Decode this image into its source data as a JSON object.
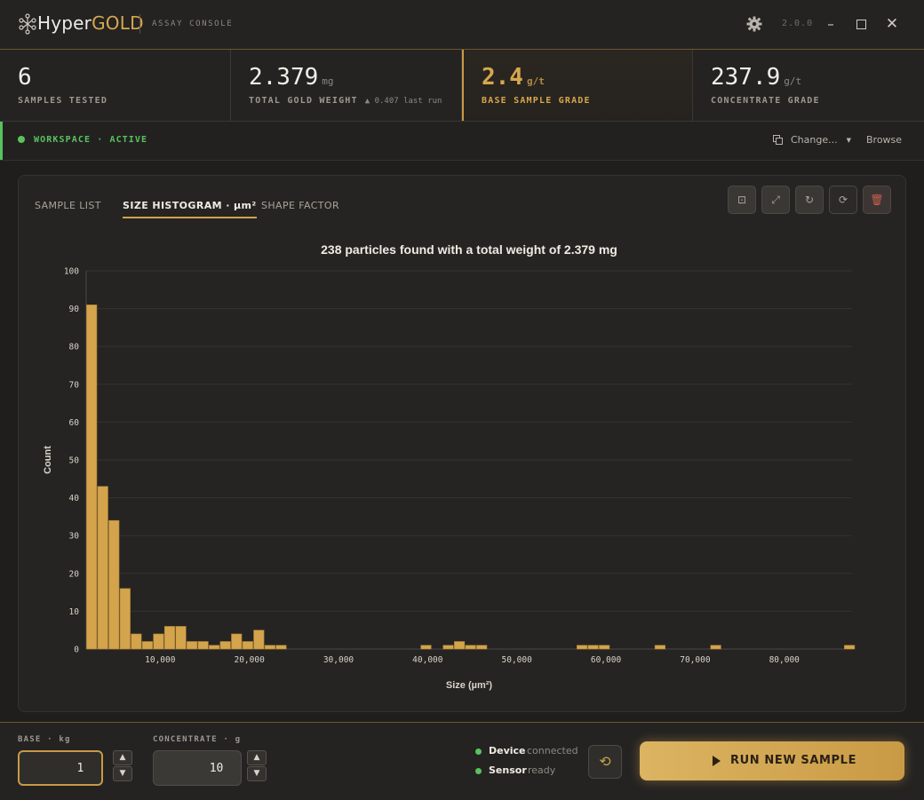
{
  "app": {
    "brand_prefix": "Hyper",
    "brand_suffix": "GOLD",
    "subtitle": "ASSAY CONSOLE",
    "version": "2.0.0"
  },
  "stats": [
    {
      "value": "6",
      "unit": "",
      "label": "SAMPLES TESTED"
    },
    {
      "value": "2.379",
      "unit": "mg",
      "label": "TOTAL GOLD WEIGHT",
      "delta": "▲ 0.407 last run"
    },
    {
      "value": "2.4",
      "unit": "g/t",
      "label": "BASE SAMPLE GRADE",
      "active": true
    },
    {
      "value": "237.9",
      "unit": "g/t",
      "label": "CONCENTRATE GRADE"
    }
  ],
  "workspace": {
    "status": "WORKSPACE · ACTIVE",
    "change_label": "Change...",
    "browse_label": "Browse"
  },
  "tabs": [
    {
      "label": "SAMPLE LIST",
      "selected": false
    },
    {
      "label": "SIZE HISTOGRAM · µm²",
      "selected": true
    },
    {
      "label": "SHAPE FACTOR",
      "selected": false
    }
  ],
  "toolbar": {
    "icons": [
      "fit-view-icon",
      "expand-icon",
      "rotate-icon",
      "reset-icon",
      "trash-icon"
    ]
  },
  "chart_data": {
    "type": "bar",
    "title": "238 particles found with a total weight of 2.379 mg",
    "xlabel": "Size (µm²)",
    "ylabel": "Count",
    "ylim": [
      0,
      100
    ],
    "xlim": [
      1700,
      87600
    ],
    "yticks": [
      "0",
      "10",
      "20",
      "30",
      "40",
      "50",
      "60",
      "70",
      "80",
      "90",
      "100"
    ],
    "xticks": [
      {
        "value": 10000,
        "label": "10,000"
      },
      {
        "value": 20000,
        "label": "20,000"
      },
      {
        "value": 30000,
        "label": "30,000"
      },
      {
        "value": 40000,
        "label": "40,000"
      },
      {
        "value": 50000,
        "label": "50,000"
      },
      {
        "value": 60000,
        "label": "60,000"
      },
      {
        "value": 70000,
        "label": "70,000"
      },
      {
        "value": 80000,
        "label": "80,000"
      }
    ],
    "bin_width": 1250,
    "bins": [
      {
        "x": 1700,
        "count": 91
      },
      {
        "x": 2950,
        "count": 43
      },
      {
        "x": 4200,
        "count": 34
      },
      {
        "x": 5450,
        "count": 16
      },
      {
        "x": 6700,
        "count": 4
      },
      {
        "x": 7950,
        "count": 2
      },
      {
        "x": 9200,
        "count": 4
      },
      {
        "x": 10450,
        "count": 6
      },
      {
        "x": 11700,
        "count": 6
      },
      {
        "x": 12950,
        "count": 2
      },
      {
        "x": 14200,
        "count": 2
      },
      {
        "x": 15450,
        "count": 1
      },
      {
        "x": 16700,
        "count": 2
      },
      {
        "x": 17950,
        "count": 4
      },
      {
        "x": 19200,
        "count": 2
      },
      {
        "x": 20450,
        "count": 5
      },
      {
        "x": 21700,
        "count": 1
      },
      {
        "x": 22950,
        "count": 1
      },
      {
        "x": 39200,
        "count": 1
      },
      {
        "x": 41700,
        "count": 1
      },
      {
        "x": 42950,
        "count": 2
      },
      {
        "x": 44200,
        "count": 1
      },
      {
        "x": 45450,
        "count": 1
      },
      {
        "x": 56700,
        "count": 1
      },
      {
        "x": 57950,
        "count": 1
      },
      {
        "x": 59200,
        "count": 1
      },
      {
        "x": 65450,
        "count": 1
      },
      {
        "x": 71700,
        "count": 1
      },
      {
        "x": 86700,
        "count": 1
      }
    ],
    "bar_color": "#d4a44c",
    "grid": true
  },
  "inputs": {
    "base_label": "BASE · kg",
    "base_value": "1",
    "concentrate_label": "CONCENTRATE · g",
    "concentrate_value": "10"
  },
  "status": [
    {
      "name": "Device",
      "state": "connected"
    },
    {
      "name": "Sensor",
      "state": "ready"
    }
  ],
  "run_button": "RUN NEW SAMPLE",
  "colors": {
    "accent": "#d4a44c",
    "ok": "#58c35d",
    "danger": "#c9614f"
  }
}
